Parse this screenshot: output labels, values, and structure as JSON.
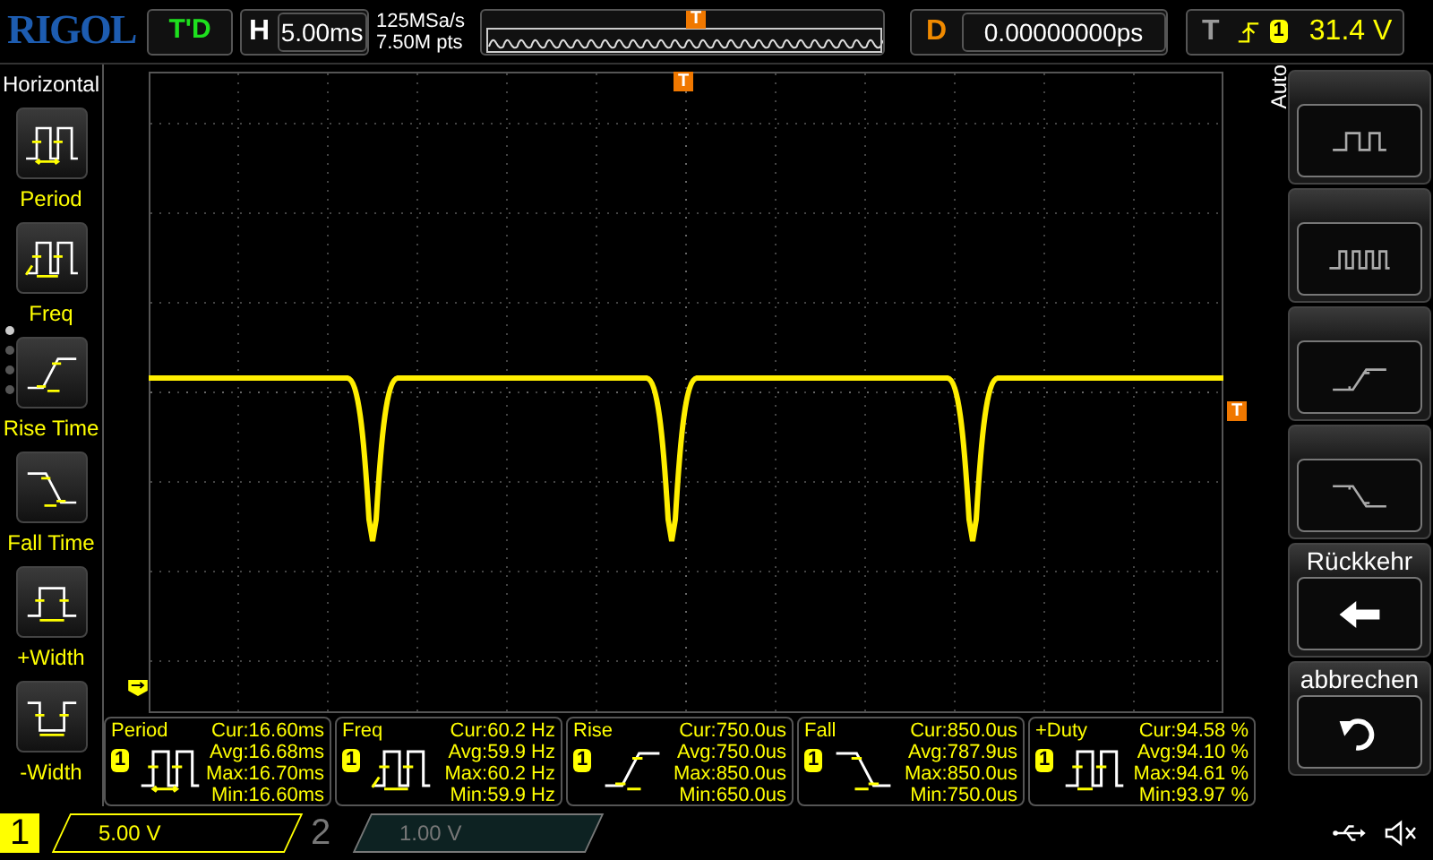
{
  "brand": "RIGOL",
  "run_status": "T'D",
  "timebase": {
    "label": "H",
    "value": "5.00ms"
  },
  "acquisition": {
    "sample_rate": "125MSa/s",
    "memory_depth": "7.50M pts"
  },
  "overview_marker": "T",
  "delay": {
    "label": "D",
    "value": "0.00000000ps"
  },
  "trigger": {
    "label": "T",
    "source": "1",
    "level": "31.4 V"
  },
  "menu": {
    "title": "Horizontal",
    "items": [
      {
        "label": "Period",
        "kind": "period"
      },
      {
        "label": "Freq",
        "kind": "freq"
      },
      {
        "label": "Rise Time",
        "kind": "rise"
      },
      {
        "label": "Fall Time",
        "kind": "fall"
      },
      {
        "label": "+Width",
        "kind": "pwidth"
      },
      {
        "label": "-Width",
        "kind": "nwidth"
      }
    ]
  },
  "page_dots": [
    {
      "selected": true
    },
    {
      "selected": false
    },
    {
      "selected": false
    },
    {
      "selected": false
    }
  ],
  "position_marker": "T",
  "level_marker": "T",
  "side_title": "Auto",
  "softkeys": [
    {
      "kind": "period"
    },
    {
      "kind": "freq"
    },
    {
      "kind": "rise"
    },
    {
      "kind": "fall"
    },
    {
      "kind": "back",
      "label": "Rückkehr"
    },
    {
      "kind": "undo",
      "label": "abbrechen"
    }
  ],
  "measurements": [
    {
      "name": "Period",
      "source": "1",
      "kind": "period",
      "lines": [
        "Cur:16.60ms",
        "Avg:16.68ms",
        "Max:16.70ms",
        "Min:16.60ms"
      ]
    },
    {
      "name": "Freq",
      "source": "1",
      "kind": "freq",
      "lines": [
        "Cur:60.2 Hz",
        "Avg:59.9 Hz",
        "Max:60.2 Hz",
        "Min:59.9 Hz"
      ]
    },
    {
      "name": "Rise",
      "source": "1",
      "kind": "rise",
      "lines": [
        "Cur:750.0us",
        "Avg:750.0us",
        "Max:850.0us",
        "Min:650.0us"
      ]
    },
    {
      "name": "Fall",
      "source": "1",
      "kind": "fall",
      "lines": [
        "Cur:850.0us",
        "Avg:787.9us",
        "Max:850.0us",
        "Min:750.0us"
      ]
    },
    {
      "name": "+Duty",
      "source": "1",
      "kind": "duty",
      "lines": [
        "Cur:94.58 %",
        "Avg:94.10 %",
        "Max:94.61 %",
        "Min:93.97 %"
      ]
    }
  ],
  "channels": [
    {
      "number": "1",
      "scale": "5.00 V",
      "enabled": true
    },
    {
      "number": "2",
      "scale": "1.00 V",
      "enabled": false
    }
  ]
}
